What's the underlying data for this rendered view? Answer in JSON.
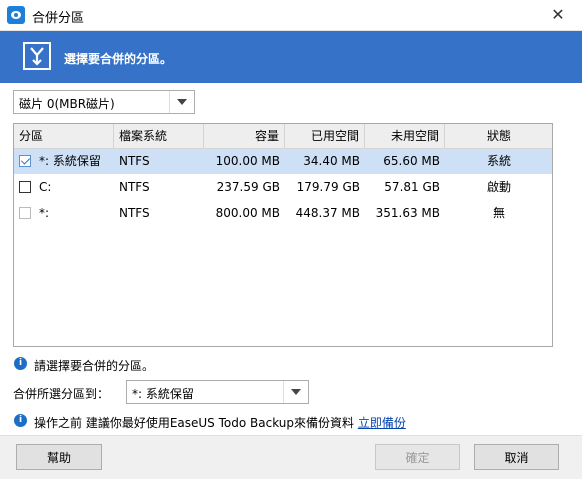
{
  "window": {
    "title": "合併分區",
    "close_glyph": "✕"
  },
  "banner": {
    "text": "選擇要合併的分區。"
  },
  "disk_select": {
    "value": "磁片 0(MBR磁片)"
  },
  "table": {
    "headers": [
      "分區",
      "檔案系統",
      "容量",
      "已用空間",
      "未用空間",
      "狀態"
    ],
    "rows": [
      {
        "name": "*: 系統保留",
        "fs": "NTFS",
        "capacity": "100.00 MB",
        "used": "34.40 MB",
        "free": "65.60 MB",
        "status": "系統",
        "checked": true,
        "selected": true
      },
      {
        "name": "C:",
        "fs": "NTFS",
        "capacity": "237.59 GB",
        "used": "179.79 GB",
        "free": "57.81 GB",
        "status": "啟動",
        "checked": false,
        "selected": false
      },
      {
        "name": "*:",
        "fs": "NTFS",
        "capacity": "800.00 MB",
        "used": "448.37 MB",
        "free": "351.63 MB",
        "status": "無",
        "checked": false,
        "selected": false
      }
    ]
  },
  "info1": "請選擇要合併的分區。",
  "merge_target": {
    "label": "合併所選分區到：",
    "value": "*: 系統保留"
  },
  "info2": {
    "text": "操作之前 建議你最好使用EaseUS Todo Backup來備份資料 ",
    "link": "立即備份"
  },
  "buttons": {
    "help": "幫助",
    "ok": "確定",
    "cancel": "取消"
  },
  "colors": {
    "banner": "#3672c8",
    "selected_row": "#cde0f6",
    "link": "#0645ad"
  }
}
